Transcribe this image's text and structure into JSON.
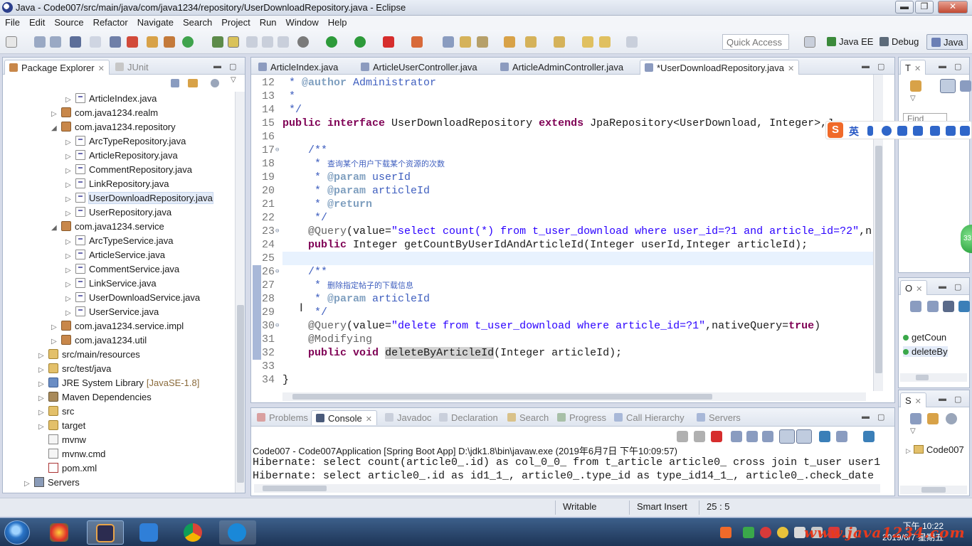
{
  "window": {
    "title": "Java - Code007/src/main/java/com/java1234/repository/UserDownloadRepository.java - Eclipse",
    "minimize": "▬",
    "maximize": "❐",
    "close": "✕"
  },
  "menu": [
    "File",
    "Edit",
    "Source",
    "Refactor",
    "Navigate",
    "Search",
    "Project",
    "Run",
    "Window",
    "Help"
  ],
  "toolbar": {
    "quick_access_placeholder": "Quick Access",
    "perspectives": [
      "Java EE",
      "Debug",
      "Java"
    ]
  },
  "package_explorer": {
    "tabs": [
      "Package Explorer",
      "JUnit"
    ],
    "rows": [
      {
        "label": "ArticleIndex.java",
        "kind": "file",
        "indent": 2,
        "arrow": "▷"
      },
      {
        "label": "com.java1234.realm",
        "kind": "pkg",
        "indent": 1,
        "arrow": "▷"
      },
      {
        "label": "com.java1234.repository",
        "kind": "pkg",
        "indent": 1,
        "arrow": "◢"
      },
      {
        "label": "ArcTypeRepository.java",
        "kind": "file",
        "indent": 2,
        "arrow": "▷"
      },
      {
        "label": "ArticleRepository.java",
        "kind": "file",
        "indent": 2,
        "arrow": "▷"
      },
      {
        "label": "CommentRepository.java",
        "kind": "file",
        "indent": 2,
        "arrow": "▷"
      },
      {
        "label": "LinkRepository.java",
        "kind": "file",
        "indent": 2,
        "arrow": "▷"
      },
      {
        "label": "UserDownloadRepository.java",
        "kind": "file",
        "indent": 2,
        "arrow": "▷",
        "selected": true
      },
      {
        "label": "UserRepository.java",
        "kind": "file",
        "indent": 2,
        "arrow": "▷"
      },
      {
        "label": "com.java1234.service",
        "kind": "pkg",
        "indent": 1,
        "arrow": "◢"
      },
      {
        "label": "ArcTypeService.java",
        "kind": "file",
        "indent": 2,
        "arrow": "▷"
      },
      {
        "label": "ArticleService.java",
        "kind": "file",
        "indent": 2,
        "arrow": "▷"
      },
      {
        "label": "CommentService.java",
        "kind": "file",
        "indent": 2,
        "arrow": "▷"
      },
      {
        "label": "LinkService.java",
        "kind": "file",
        "indent": 2,
        "arrow": "▷"
      },
      {
        "label": "UserDownloadService.java",
        "kind": "file",
        "indent": 2,
        "arrow": "▷"
      },
      {
        "label": "UserService.java",
        "kind": "file",
        "indent": 2,
        "arrow": "▷"
      },
      {
        "label": "com.java1234.service.impl",
        "kind": "pkg",
        "indent": 1,
        "arrow": "▷"
      },
      {
        "label": "com.java1234.util",
        "kind": "pkg",
        "indent": 1,
        "arrow": "▷"
      },
      {
        "label": "src/main/resources",
        "kind": "folder",
        "indent": 0,
        "arrow": "▷"
      },
      {
        "label": "src/test/java",
        "kind": "folder",
        "indent": 0,
        "arrow": "▷"
      },
      {
        "label": "JRE System Library",
        "suffix": "[JavaSE-1.8]",
        "kind": "jre",
        "indent": 0,
        "arrow": "▷"
      },
      {
        "label": "Maven Dependencies",
        "kind": "lib",
        "indent": 0,
        "arrow": "▷"
      },
      {
        "label": "src",
        "kind": "folder",
        "indent": 0,
        "arrow": "▷"
      },
      {
        "label": "target",
        "kind": "folder",
        "indent": 0,
        "arrow": "▷"
      },
      {
        "label": "mvnw",
        "kind": "doc",
        "indent": 0,
        "arrow": ""
      },
      {
        "label": "mvnw.cmd",
        "kind": "doc",
        "indent": 0,
        "arrow": ""
      },
      {
        "label": "pom.xml",
        "kind": "xml",
        "indent": 0,
        "arrow": ""
      },
      {
        "label": "Servers",
        "kind": "srv",
        "indent": -1,
        "arrow": "▷"
      }
    ]
  },
  "editor": {
    "tabs": [
      "ArticleIndex.java",
      "ArticleUserController.java",
      "ArticleAdminController.java",
      "*UserDownloadRepository.java"
    ],
    "lines": [
      {
        "n": "12",
        "html": "<span class='cmt'> * <span class='cmtag'>@author</span> Administrator</span>"
      },
      {
        "n": "13",
        "html": "<span class='cmt'> *</span>"
      },
      {
        "n": "14",
        "html": "<span class='cmt'> */</span>"
      },
      {
        "n": "15",
        "html": "<span class='kw'>public</span> <span class='kw'>interface</span> UserDownloadRepository <span class='kw'>extends</span> JpaRepository&lt;UserDownload, Integer&gt;,J"
      },
      {
        "n": "16",
        "html": ""
      },
      {
        "n": "17",
        "fold": true,
        "html": "    <span class='cmt'>/**</span>"
      },
      {
        "n": "18",
        "html": "<span class='cmt'>     * <span class='cn'>查询某个用户下载某个资源的次数</span></span>"
      },
      {
        "n": "19",
        "html": "<span class='cmt'>     * <span class='cmtag'>@param</span> userId</span>"
      },
      {
        "n": "20",
        "html": "<span class='cmt'>     * <span class='cmtag'>@param</span> articleId</span>"
      },
      {
        "n": "21",
        "html": "<span class='cmt'>     * <span class='cmtag'>@return</span></span>"
      },
      {
        "n": "22",
        "html": "<span class='cmt'>     */</span>"
      },
      {
        "n": "23",
        "fold": true,
        "html": "    <span class='ann'>@Query</span>(value=<span class='str'>\"select count(*) from t_user_download where user_id=?1 and article_id=?2\"</span>,n"
      },
      {
        "n": "24",
        "html": "    <span class='kw'>public</span> Integer getCountByUserIdAndArticleId(Integer userId,Integer articleId);"
      },
      {
        "n": "25",
        "html": "",
        "current": true
      },
      {
        "n": "26",
        "fold": true,
        "html": "    <span class='cmt'>/**</span>"
      },
      {
        "n": "27",
        "html": "<span class='cmt'>     * <span class='cn'>删除指定帖子的下载信息</span></span>"
      },
      {
        "n": "28",
        "html": "<span class='cmt'>     * <span class='cmtag'>@param</span> articleId</span>"
      },
      {
        "n": "29",
        "html": "<span class='cmt'>     */</span>"
      },
      {
        "n": "30",
        "fold": true,
        "html": "    <span class='ann'>@Query</span>(value=<span class='str'>\"delete from t_user_download where article_id=?1\"</span>,nativeQuery=<span class='kw'>true</span>)"
      },
      {
        "n": "31",
        "html": "    <span class='ann'>@Modifying</span>"
      },
      {
        "n": "32",
        "html": "    <span class='kw'>public</span> <span class='kw'>void</span> <span class='mark'>deleteByArticleId</span>(Integer articleId);"
      },
      {
        "n": "33",
        "html": ""
      },
      {
        "n": "34",
        "html": "}"
      }
    ]
  },
  "console": {
    "tabs": [
      "Problems",
      "Console",
      "Javadoc",
      "Declaration",
      "Search",
      "Progress",
      "Call Hierarchy",
      "Servers"
    ],
    "launch": "Code007 - Code007Application [Spring Boot App] D:\\jdk1.8\\bin\\javaw.exe (2019年6月7日 下午10:09:57)",
    "output": [
      "Hibernate: select count(article0_.id) as col_0_0_ from t_article article0_ cross join t_user user1",
      "Hibernate: select article0_.id as id1_1_, article0_.type_id as type_id14_1_, article0_.check_date"
    ]
  },
  "right_panels": {
    "task_tab": "T",
    "find_placeholder": "Find",
    "outline_tab": "O",
    "outline_items": [
      "getCoun",
      "deleteBy"
    ],
    "servers_tab": "S",
    "servers_item": "Code007"
  },
  "ime": {
    "logo": "S",
    "lang": "英"
  },
  "badge": "33",
  "status": {
    "writable": "Writable",
    "insert": "Smart Insert",
    "position": "25 : 5"
  },
  "taskbar": {
    "time": "下午 10:22",
    "date": "2019/6/7 星期五",
    "watermark": "www.java1234.com"
  }
}
